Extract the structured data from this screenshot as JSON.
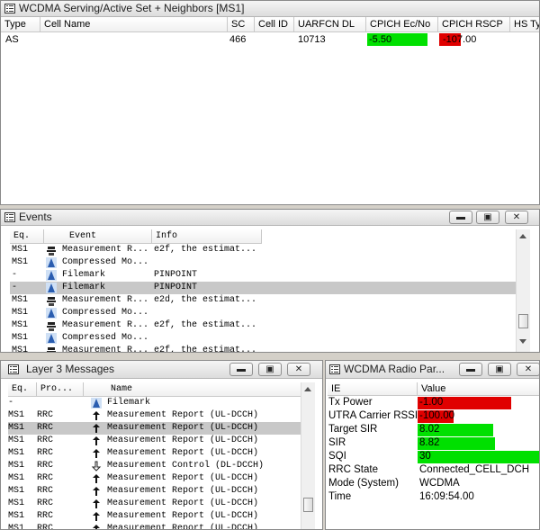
{
  "serving": {
    "title": "WCDMA Serving/Active Set + Neighbors [MS1]",
    "columns": [
      "Type",
      "Cell Name",
      "SC",
      "Cell ID",
      "UARFCN DL",
      "CPICH Ec/No",
      "CPICH RSCP",
      "HS Ty"
    ],
    "row": {
      "type": "AS",
      "cell_name": "",
      "sc": "466",
      "cell_id": "",
      "uarfcn": "10713",
      "ecno": "-5.50",
      "rscp": "-107.00"
    },
    "ecno_color": "#00e000",
    "rscp_color": "#e00000"
  },
  "events": {
    "title": "Events",
    "columns": [
      "Eq.",
      "Event",
      "Info"
    ],
    "rows": [
      {
        "eq": "MS1",
        "icon": "ue-phone-icon",
        "event": "Measurement R...",
        "info": "e2f, the estimat..."
      },
      {
        "eq": "MS1",
        "icon": "tower-icon",
        "event": "Compressed Mo...",
        "info": ""
      },
      {
        "eq": "-",
        "icon": "tower-icon",
        "event": "Filemark",
        "info": "PINPOINT"
      },
      {
        "eq": "-",
        "icon": "tower-icon",
        "event": "Filemark",
        "info": "PINPOINT"
      },
      {
        "eq": "MS1",
        "icon": "ue-phone-icon",
        "event": "Measurement R...",
        "info": "e2d, the estimat..."
      },
      {
        "eq": "MS1",
        "icon": "tower-icon",
        "event": "Compressed Mo...",
        "info": ""
      },
      {
        "eq": "MS1",
        "icon": "ue-phone-icon",
        "event": "Measurement R...",
        "info": "e2f, the estimat..."
      },
      {
        "eq": "MS1",
        "icon": "tower-icon",
        "event": "Compressed Mo...",
        "info": ""
      },
      {
        "eq": "MS1",
        "icon": "ue-phone-icon",
        "event": "Measurement R...",
        "info": "e2f, the estimat..."
      }
    ]
  },
  "l3": {
    "title": "Layer 3 Messages",
    "columns": [
      "Eq.",
      "Pro...",
      "Name"
    ],
    "rows": [
      {
        "eq": "-",
        "proto": "",
        "dir": "tower-icon",
        "name": "Filemark"
      },
      {
        "eq": "MS1",
        "proto": "RRC",
        "dir": "up-arrow-icon",
        "name": "Measurement Report (UL-DCCH)"
      },
      {
        "eq": "MS1",
        "proto": "RRC",
        "dir": "up-arrow-icon",
        "name": "Measurement Report (UL-DCCH)"
      },
      {
        "eq": "MS1",
        "proto": "RRC",
        "dir": "up-arrow-icon",
        "name": "Measurement Report (UL-DCCH)"
      },
      {
        "eq": "MS1",
        "proto": "RRC",
        "dir": "up-arrow-icon",
        "name": "Measurement Report (UL-DCCH)"
      },
      {
        "eq": "MS1",
        "proto": "RRC",
        "dir": "down-arrow-icon",
        "name": "Measurement Control (DL-DCCH)"
      },
      {
        "eq": "MS1",
        "proto": "RRC",
        "dir": "up-arrow-icon",
        "name": "Measurement Report (UL-DCCH)"
      },
      {
        "eq": "MS1",
        "proto": "RRC",
        "dir": "up-arrow-icon",
        "name": "Measurement Report (UL-DCCH)"
      },
      {
        "eq": "MS1",
        "proto": "RRC",
        "dir": "up-arrow-icon",
        "name": "Measurement Report (UL-DCCH)"
      },
      {
        "eq": "MS1",
        "proto": "RRC",
        "dir": "up-arrow-icon",
        "name": "Measurement Report (UL-DCCH)"
      },
      {
        "eq": "MS1",
        "proto": "RRC",
        "dir": "up-arrow-icon",
        "name": "Measurement Report (UL-DCCH)"
      }
    ]
  },
  "radio": {
    "title": "WCDMA Radio Par...",
    "columns": [
      "IE",
      "Value"
    ],
    "rows": [
      {
        "ie": "Tx Power",
        "value": "-1.00",
        "bar_color": "#e00000"
      },
      {
        "ie": "UTRA Carrier RSSI",
        "value": "-100.00",
        "bar_color": "#e00000"
      },
      {
        "ie": "Target SIR",
        "value": "8.02",
        "bar_color": "#00e000"
      },
      {
        "ie": "SIR",
        "value": "8.82",
        "bar_color": "#00e000"
      },
      {
        "ie": "SQI",
        "value": "30",
        "bar_color": "#00e000"
      },
      {
        "ie": "RRC State",
        "value": "Connected_CELL_DCH"
      },
      {
        "ie": "Mode (System)",
        "value": "WCDMA"
      },
      {
        "ie": "Time",
        "value": "16:09:54.00"
      }
    ]
  },
  "buttons": {
    "minimize": "▬",
    "restore": "▣",
    "close": "✕"
  }
}
